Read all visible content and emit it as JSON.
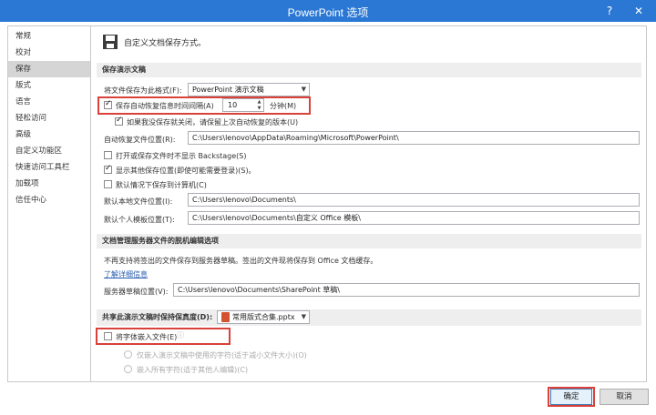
{
  "window": {
    "title": "PowerPoint 选项",
    "help_glyph": "?",
    "close_glyph": "✕"
  },
  "sidebar": {
    "items": [
      {
        "label": "常规"
      },
      {
        "label": "校对"
      },
      {
        "label": "保存",
        "selected": true
      },
      {
        "label": "版式"
      },
      {
        "label": "语言"
      },
      {
        "label": "轻松访问"
      },
      {
        "label": "高级"
      },
      {
        "label": "自定义功能区"
      },
      {
        "label": "快速访问工具栏"
      },
      {
        "label": "加载项"
      },
      {
        "label": "信任中心"
      }
    ]
  },
  "header": {
    "icon": "save-icon",
    "text": "自定义文档保存方式。"
  },
  "save_presentations": {
    "heading": "保存演示文稿",
    "format_label": "将文件保存为此格式(F):",
    "format_value": "PowerPoint 演示文稿",
    "autorecover_label": "保存自动恢复信息时间间隔(A)",
    "autorecover_checked": true,
    "autorecover_minutes": "10",
    "minutes_label": "分钟(M)",
    "keep_last_label": "如果我没保存就关闭，请保留上次自动恢复的版本(U)",
    "keep_last_checked": true,
    "autorecover_loc_label": "自动恢复文件位置(R):",
    "autorecover_loc_value": "C:\\Users\\lenovo\\AppData\\Roaming\\Microsoft\\PowerPoint\\",
    "no_backstage_label": "打开或保存文件时不显示 Backstage(S)",
    "no_backstage_checked": false,
    "show_other_label": "显示其他保存位置(即使可能需要登录)(S)。",
    "show_other_checked": true,
    "default_computer_label": "默认情况下保存到计算机(C)",
    "default_computer_checked": false,
    "default_local_label": "默认本地文件位置(I):",
    "default_local_value": "C:\\Users\\lenovo\\Documents\\",
    "default_template_label": "默认个人模板位置(T):",
    "default_template_value": "C:\\Users\\lenovo\\Documents\\自定义 Office 模板\\"
  },
  "offline_editing": {
    "heading": "文档管理服务器文件的脱机编辑选项",
    "description": "不再支持将签出的文件保存到服务器草稿。签出的文件现将保存到 Office 文档缓存。",
    "learn_more": "了解详细信息",
    "drafts_label": "服务器草稿位置(V):",
    "drafts_value": "C:\\Users\\lenovo\\Documents\\SharePoint 草稿\\"
  },
  "fidelity": {
    "heading": "共享此演示文稿时保持保真度(D):",
    "file_value": "常用版式合集.pptx",
    "embed_label": "将字体嵌入文件(E)",
    "embed_checked": false,
    "info_glyph": "ⓘ",
    "embed_used_label": "仅嵌入演示文稿中使用的字符(适于减小文件大小)(O)",
    "embed_all_label": "嵌入所有字符(适于其他人编辑)(C)"
  },
  "buttons": {
    "ok": "确定",
    "cancel": "取消"
  },
  "colors": {
    "titlebar": "#2b78d4",
    "highlight": "#d9413a",
    "selected_sidebar": "#d5d5d5"
  }
}
